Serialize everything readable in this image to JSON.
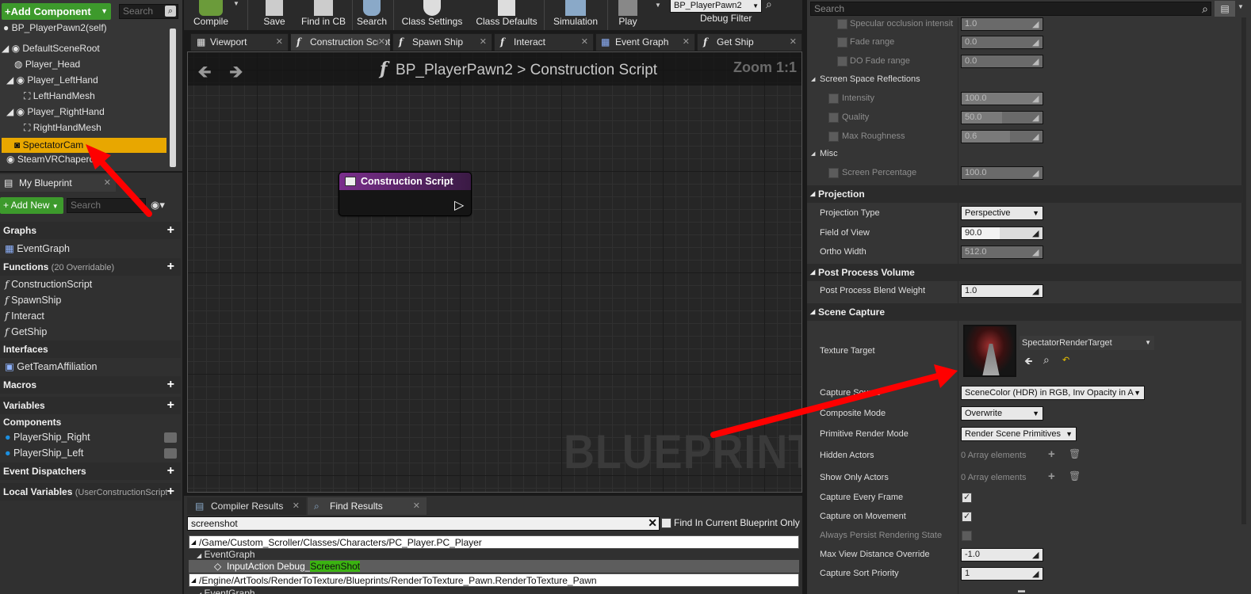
{
  "left_top": {
    "add_component": "+Add Component",
    "search_placeholder": "Search",
    "self_label": "BP_PlayerPawn2(self)",
    "tree": [
      "DefaultSceneRoot",
      "Player_Head",
      "Player_LeftHand",
      "LeftHandMesh",
      "Player_RightHand",
      "RightHandMesh",
      "SpectatorCam",
      "SteamVRChaperone"
    ]
  },
  "my_blueprint": {
    "tab": "My Blueprint",
    "add_new": "+ Add New",
    "search_placeholder": "Search",
    "graphs": "Graphs",
    "event_graph": "EventGraph",
    "functions": "Functions",
    "functions_note": "(20 Overridable)",
    "function_items": [
      "ConstructionScript",
      "SpawnShip",
      "Interact",
      "GetShip"
    ],
    "interfaces": "Interfaces",
    "interface_item": "GetTeamAffiliation",
    "macros": "Macros",
    "variables": "Variables",
    "components": "Components",
    "variable_items": [
      "PlayerShip_Right",
      "PlayerShip_Left"
    ],
    "event_dispatchers": "Event Dispatchers",
    "local_variables": "Local Variables",
    "local_note": "(UserConstructionScript)"
  },
  "toolbar": {
    "compile": "Compile",
    "save": "Save",
    "find_in_cb": "Find in CB",
    "search": "Search",
    "class_settings": "Class Settings",
    "class_defaults": "Class Defaults",
    "simulation": "Simulation",
    "play": "Play",
    "debug_select": "BP_PlayerPawn2",
    "debug_filter": "Debug Filter"
  },
  "tabs": [
    "Viewport",
    "Construction Script",
    "Spawn Ship",
    "Interact",
    "Event Graph",
    "Get Ship"
  ],
  "graph": {
    "breadcrumb_bp": "BP_PlayerPawn2",
    "breadcrumb_sep": ">",
    "breadcrumb_script": "Construction Script",
    "zoom": "Zoom 1:1",
    "node_title": "Construction Script",
    "watermark": "BLUEPRINT"
  },
  "bottom": {
    "tab_compiler": "Compiler Results",
    "tab_find": "Find Results",
    "search_value": "screenshot",
    "find_in_current": "Find In Current Blueprint Only",
    "results": [
      "/Game/Custom_Scroller/Classes/Characters/PC_Player.PC_Player",
      "EventGraph",
      "InputAction Debug_",
      "ScreenShot",
      "/Engine/ArtTools/RenderToTexture/Blueprints/RenderToTexture_Pawn.RenderToTexture_Pawn",
      "EventGraph"
    ]
  },
  "details": {
    "search_placeholder": "Search",
    "rows_top": [
      {
        "label": "Specular occlusion intensit",
        "value": "1.0"
      },
      {
        "label": "Fade range",
        "value": "0.0"
      },
      {
        "label": "DO Fade range",
        "value": "0.0"
      }
    ],
    "ssr": "Screen Space Reflections",
    "ssr_rows": [
      {
        "label": "Intensity",
        "value": "100.0",
        "fill": 1.0
      },
      {
        "label": "Quality",
        "value": "50.0",
        "fill": 0.5
      },
      {
        "label": "Max Roughness",
        "value": "0.6",
        "fill": 0.6
      }
    ],
    "misc": "Misc",
    "screen_pct": {
      "label": "Screen Percentage",
      "value": "100.0"
    },
    "projection": "Projection",
    "projection_type": {
      "label": "Projection Type",
      "value": "Perspective"
    },
    "fov": {
      "label": "Field of View",
      "value": "90.0"
    },
    "ortho": {
      "label": "Ortho Width",
      "value": "512.0"
    },
    "ppv": "Post Process Volume",
    "ppbw": {
      "label": "Post Process Blend Weight",
      "value": "1.0"
    },
    "scene_capture": "Scene Capture",
    "texture_target": {
      "label": "Texture Target",
      "value": "SpectatorRenderTarget"
    },
    "capture_source": {
      "label": "Capture Source",
      "value": "SceneColor (HDR) in RGB, Inv Opacity in A"
    },
    "composite": {
      "label": "Composite Mode",
      "value": "Overwrite"
    },
    "prim_mode": {
      "label": "Primitive Render Mode",
      "value": "Render Scene Primitives"
    },
    "hidden": {
      "label": "Hidden Actors",
      "value": "0 Array elements"
    },
    "show_only": {
      "label": "Show Only Actors",
      "value": "0 Array elements"
    },
    "every_frame": {
      "label": "Capture Every Frame",
      "checked": true
    },
    "on_movement": {
      "label": "Capture on Movement",
      "checked": true
    },
    "persist": {
      "label": "Always Persist Rendering State",
      "checked": false
    },
    "max_view": {
      "label": "Max View Distance Override",
      "value": "-1.0"
    },
    "sort_priority": {
      "label": "Capture Sort Priority",
      "value": "1"
    }
  },
  "colors": {
    "accent": "#e8a700",
    "arrow": "#ff0000",
    "node": "#7a2e8c",
    "green": "#3d9a2c"
  }
}
